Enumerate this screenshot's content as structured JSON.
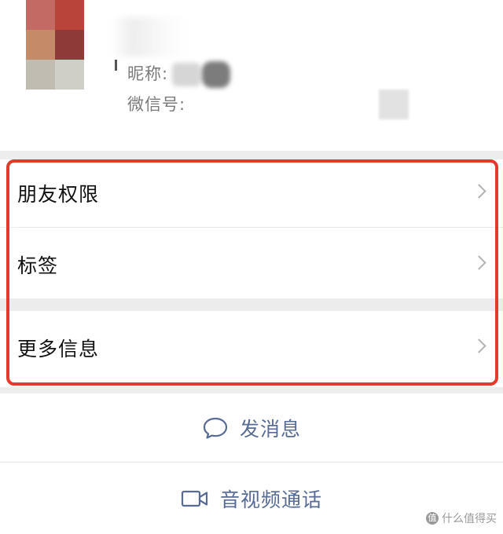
{
  "profile": {
    "nickname_label": "昵称:",
    "wechat_id_label": "微信号:"
  },
  "menu": {
    "items": [
      {
        "label": "朋友权限"
      },
      {
        "label": "标签"
      },
      {
        "label": "更多信息"
      }
    ],
    "highlight_color": "#e4392b"
  },
  "actions": {
    "send_message": "发消息",
    "av_call": "音视频通话",
    "accent_color": "#576b95"
  },
  "watermark": {
    "text": "什么值得买",
    "logo_glyph": "值"
  }
}
